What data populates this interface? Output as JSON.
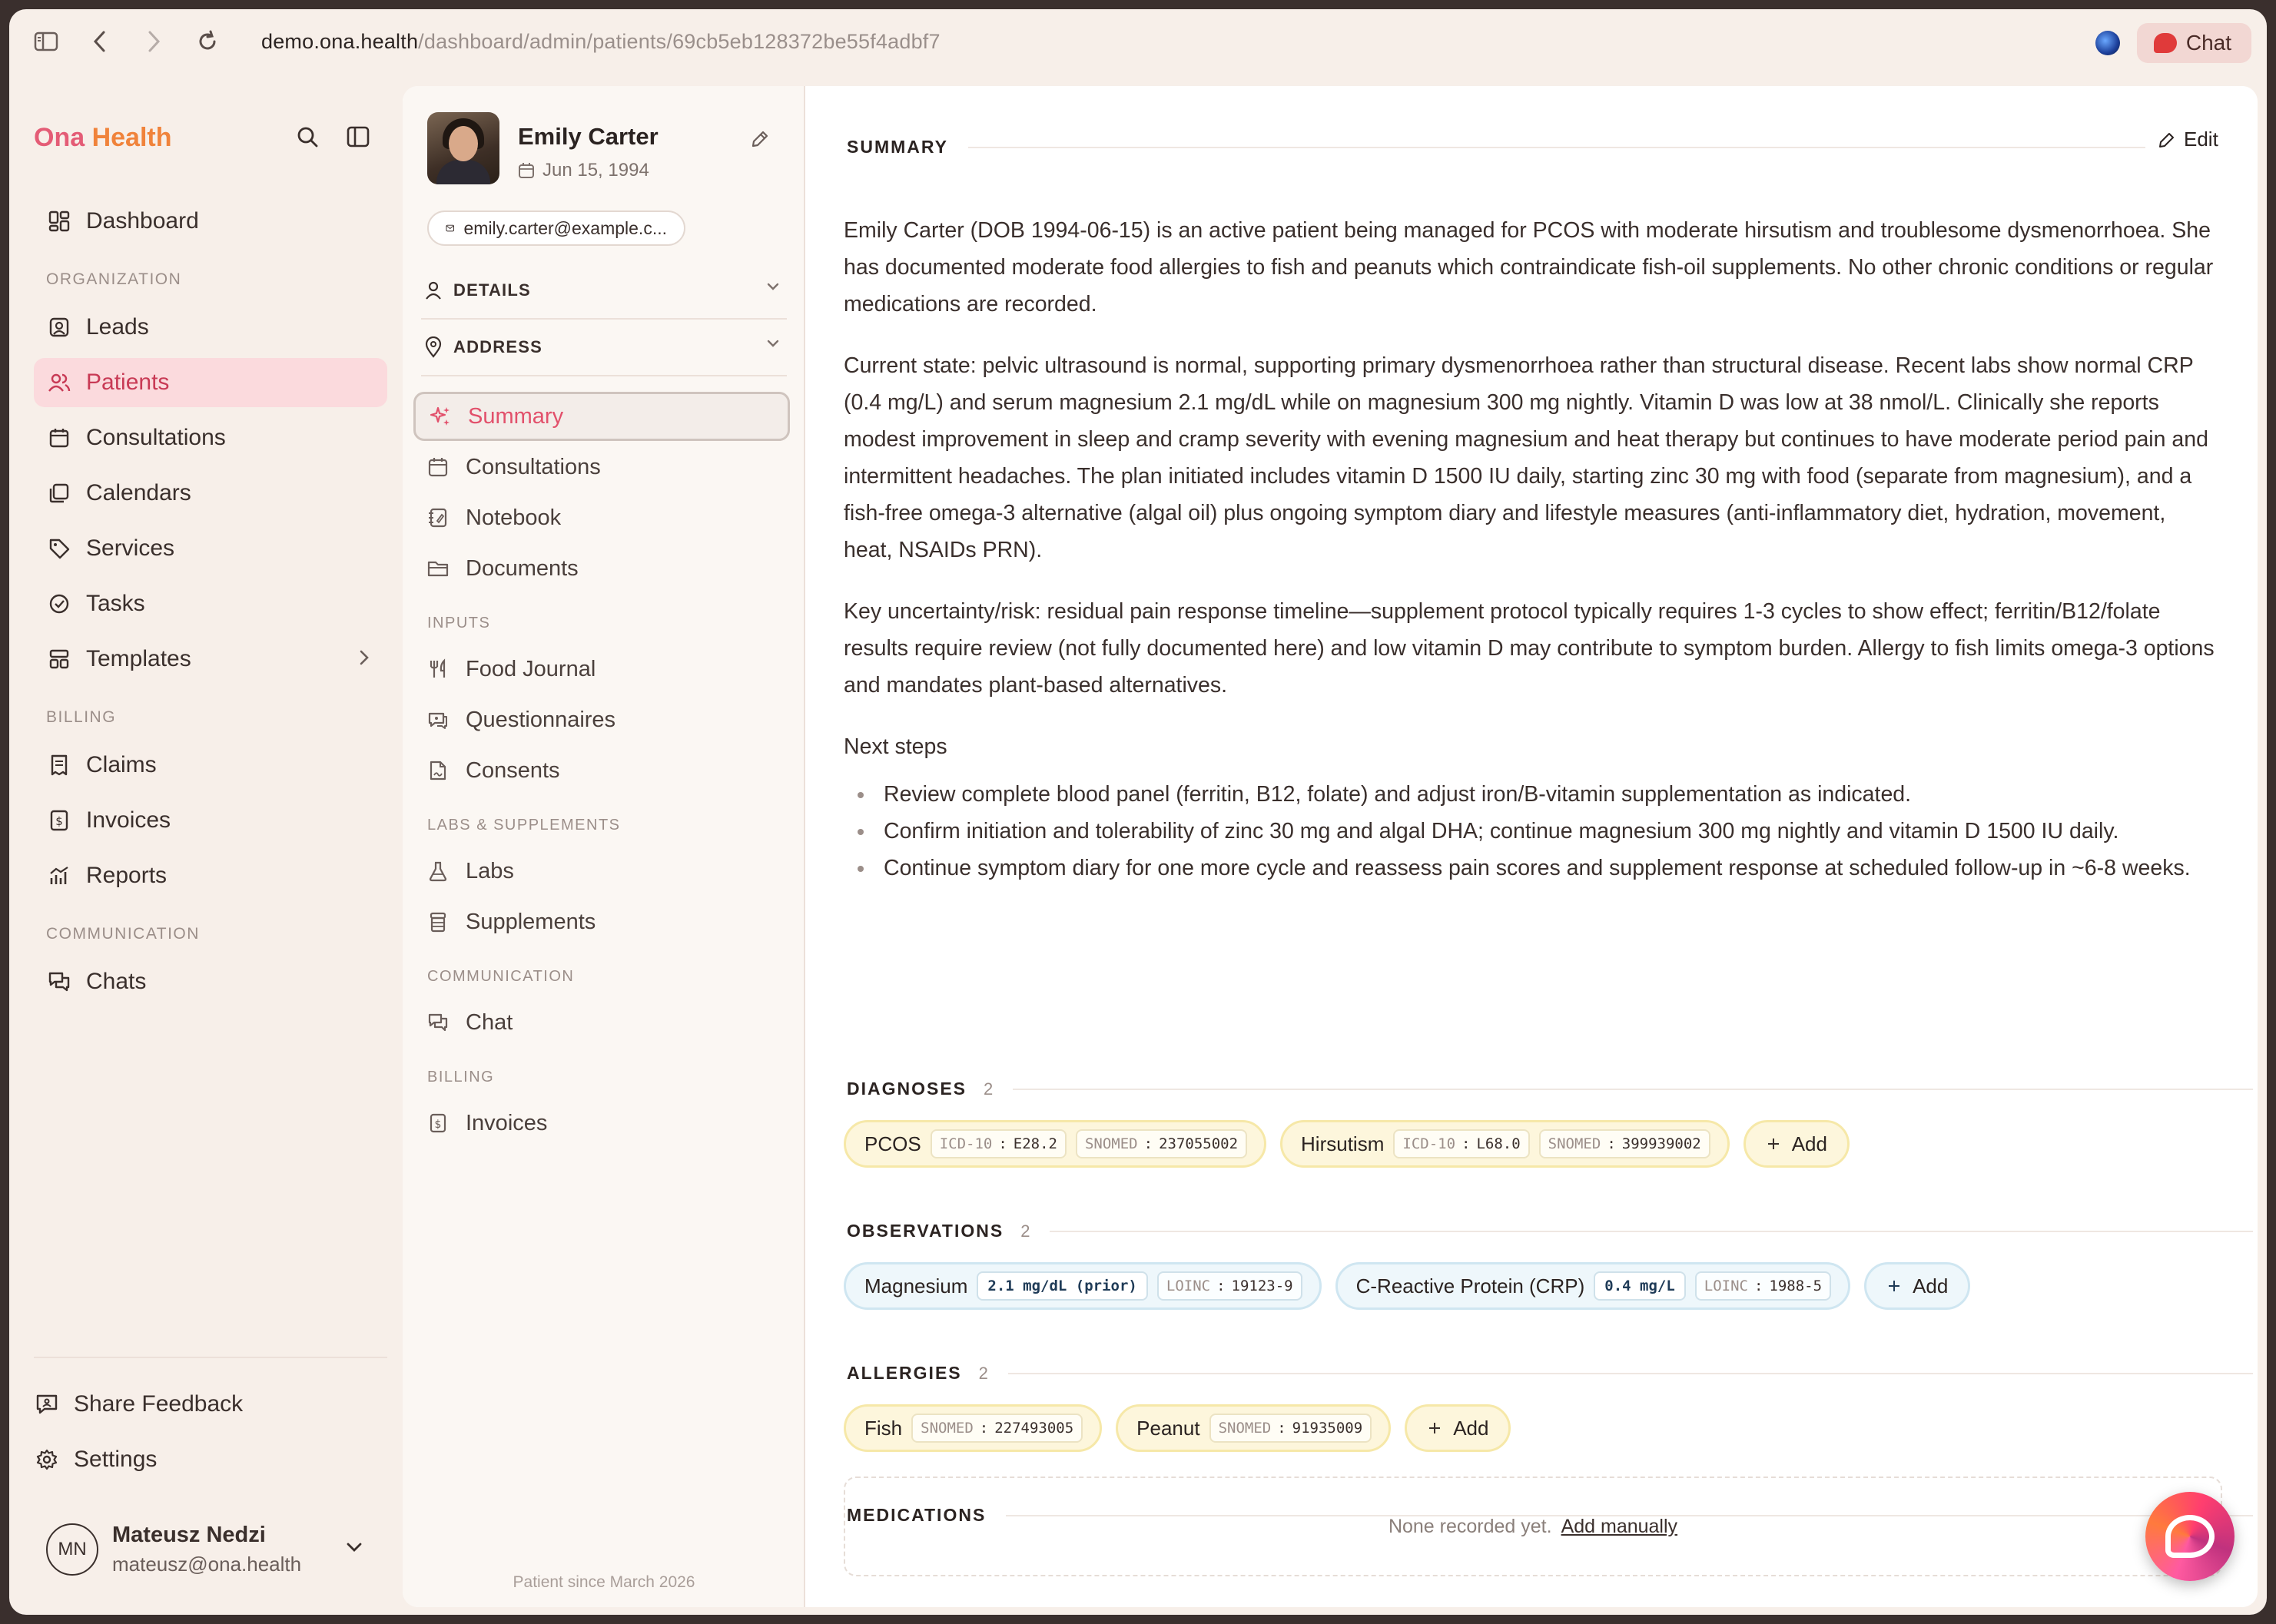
{
  "browser": {
    "url_host": "demo.ona.health",
    "url_path": "/dashboard/admin/patients/69cb5eb128372be55f4adbf7",
    "chat_label": "Chat"
  },
  "sidebar": {
    "brand": "Ona Health",
    "items": {
      "dashboard": "Dashboard",
      "leads": "Leads",
      "patients": "Patients",
      "consultations": "Consultations",
      "calendars": "Calendars",
      "services": "Services",
      "tasks": "Tasks",
      "templates": "Templates",
      "claims": "Claims",
      "invoices": "Invoices",
      "reports": "Reports",
      "chats": "Chats",
      "share_feedback": "Share Feedback",
      "settings": "Settings"
    },
    "sections": {
      "organization": "ORGANIZATION",
      "billing": "BILLING",
      "communication": "COMMUNICATION"
    },
    "user": {
      "initials": "MN",
      "name": "Mateusz Nedzi",
      "email": "mateusz@ona.health"
    }
  },
  "patient": {
    "name": "Emily Carter",
    "dob": "Jun 15, 1994",
    "email": "emily.carter@example.c...",
    "details_label": "DETAILS",
    "address_label": "ADDRESS",
    "since": "Patient since March 2026",
    "nav": {
      "summary": "Summary",
      "consultations": "Consultations",
      "notebook": "Notebook",
      "documents": "Documents",
      "inputs_section": "INPUTS",
      "food_journal": "Food Journal",
      "questionnaires": "Questionnaires",
      "consents": "Consents",
      "labs_section": "LABS & SUPPLEMENTS",
      "labs": "Labs",
      "supplements": "Supplements",
      "communication_section": "COMMUNICATION",
      "chat": "Chat",
      "billing_section": "BILLING",
      "invoices": "Invoices"
    }
  },
  "summary": {
    "title": "SUMMARY",
    "edit_label": "Edit",
    "para1": "Emily Carter (DOB 1994-06-15) is an active patient being managed for PCOS with moderate hirsutism and troublesome dysmenorrhoea. She has documented moderate food allergies to fish and peanuts which contraindicate fish-oil supplements. No other chronic conditions or regular medications are recorded.",
    "para2": "Current state: pelvic ultrasound is normal, supporting primary dysmenorrhoea rather than structural disease. Recent labs show normal CRP (0.4 mg/L) and serum magnesium 2.1 mg/dL while on magnesium 300 mg nightly. Vitamin D was low at 38 nmol/L. Clinically she reports modest improvement in sleep and cramp severity with evening magnesium and heat therapy but continues to have moderate period pain and intermittent headaches. The plan initiated includes vitamin D 1500 IU daily, starting zinc 30 mg with food (separate from magnesium), and a fish-free omega-3 alternative (algal oil) plus ongoing symptom diary and lifestyle measures (anti-inflammatory diet, hydration, movement, heat, NSAIDs PRN).",
    "para3": "Key uncertainty/risk: residual pain response timeline—supplement protocol typically requires 1-3 cycles to show effect; ferritin/B12/folate results require review (not fully documented here) and low vitamin D may contribute to symptom burden. Allergy to fish limits omega-3 options and mandates plant-based alternatives.",
    "next_steps_title": "Next steps",
    "next_steps": [
      "Review complete blood panel (ferritin, B12, folate) and adjust iron/B-vitamin supplementation as indicated.",
      "Confirm initiation and tolerability of zinc 30 mg and algal DHA; continue magnesium 300 mg nightly and vitamin D 1500 IU daily.",
      "Continue symptom diary for one more cycle and reassess pain scores and supplement response at scheduled follow-up in ~6-8 weeks."
    ]
  },
  "diagnoses": {
    "title": "DIAGNOSES",
    "count": "2",
    "items": [
      {
        "name": "PCOS",
        "icd_key": "ICD-10",
        "icd": "E28.2",
        "snomed_key": "SNOMED",
        "snomed": "237055002"
      },
      {
        "name": "Hirsutism",
        "icd_key": "ICD-10",
        "icd": "L68.0",
        "snomed_key": "SNOMED",
        "snomed": "399939002"
      }
    ],
    "add_label": "Add"
  },
  "observations": {
    "title": "OBSERVATIONS",
    "count": "2",
    "items": [
      {
        "name": "Magnesium",
        "value": "2.1 mg/dL (prior)",
        "loinc_key": "LOINC",
        "loinc": "19123-9"
      },
      {
        "name": "C-Reactive Protein (CRP)",
        "value": "0.4 mg/L",
        "loinc_key": "LOINC",
        "loinc": "1988-5"
      }
    ],
    "add_label": "Add"
  },
  "allergies": {
    "title": "ALLERGIES",
    "count": "2",
    "items": [
      {
        "name": "Fish",
        "snomed_key": "SNOMED",
        "snomed": "227493005"
      },
      {
        "name": "Peanut",
        "snomed_key": "SNOMED",
        "snomed": "91935009"
      }
    ],
    "add_label": "Add"
  },
  "medications": {
    "title": "MEDICATIONS",
    "empty_text": "None recorded yet.",
    "add_manually": "Add manually"
  },
  "colors": {
    "brand_pink": "#e45c76",
    "brand_orange": "#f0833b",
    "active_bg": "#fbdadd",
    "yellow_chip": "#fdf6dc",
    "blue_chip": "#eef7fb"
  }
}
